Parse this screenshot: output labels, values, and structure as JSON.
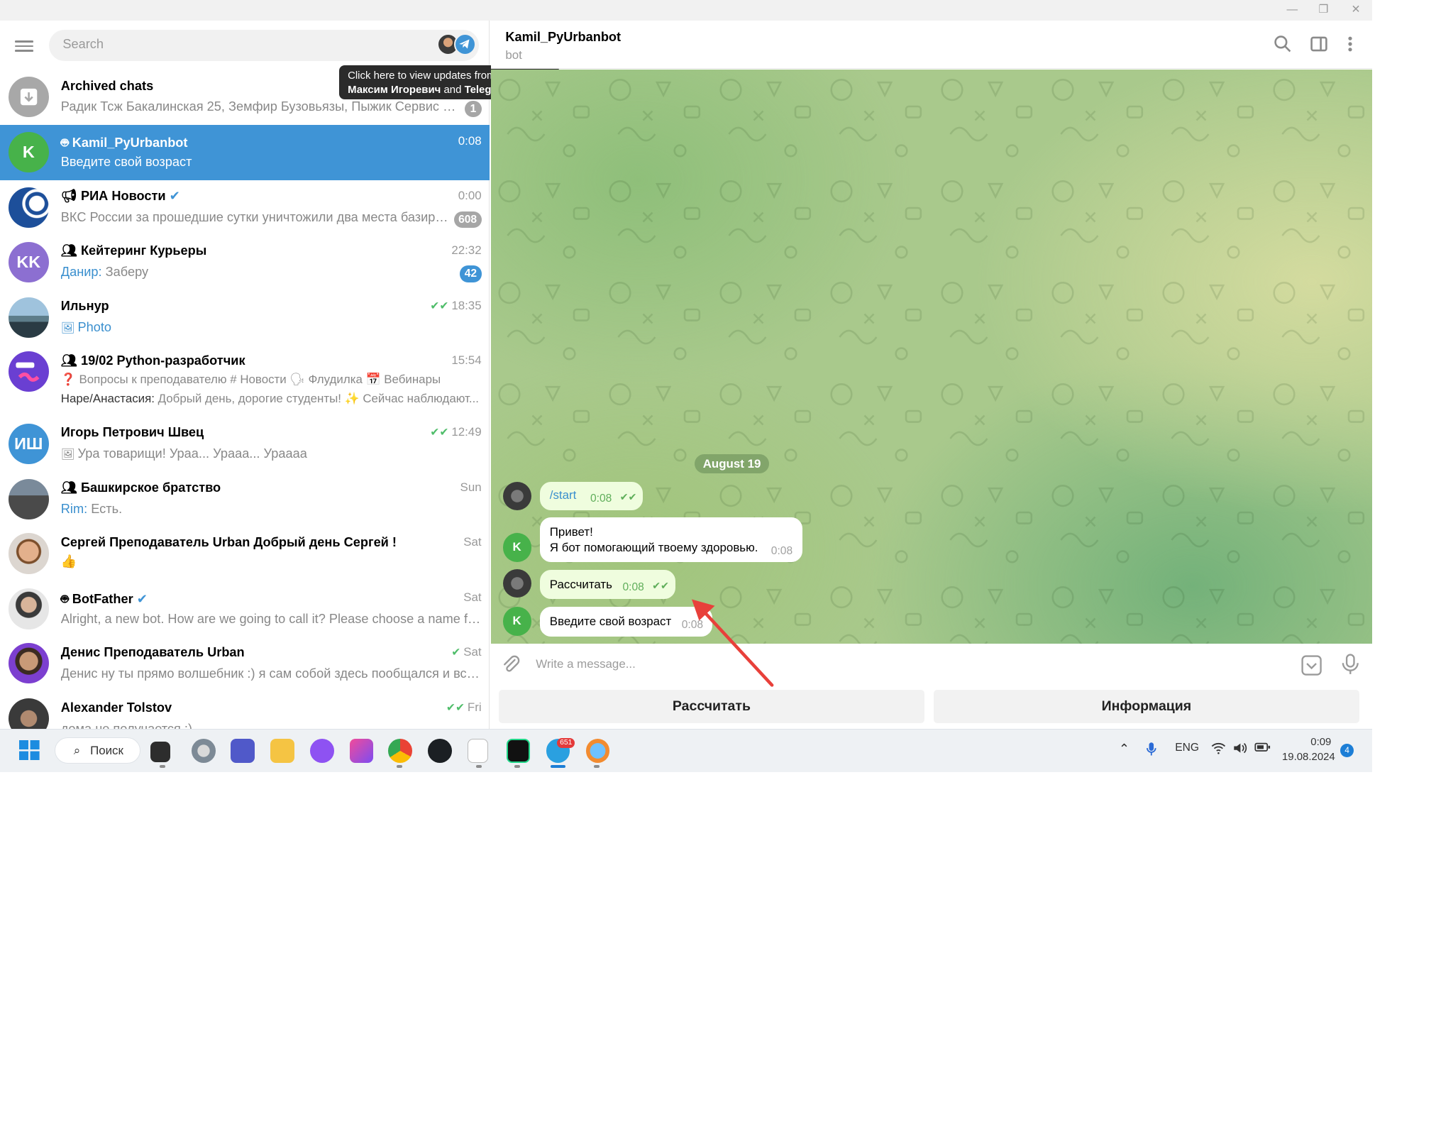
{
  "window": {
    "minimize": "—",
    "restore": "❐",
    "close": "✕"
  },
  "search": {
    "placeholder": "Search"
  },
  "tooltip": {
    "line1": "Click here to view updates from",
    "name1": "Максим Игоревич",
    "and": " and ",
    "name2": "Telegram",
    "dot": "."
  },
  "chats": [
    {
      "name": "Archived chats",
      "preview": "Радик Тсж Бакалинская 25, Земфир Бузовьязы, Пыжик Сервис На Бака...",
      "badge": "1"
    },
    {
      "name": "Kamil_PyUrbanbot",
      "time": "0:08",
      "preview": "Введите свой возраст",
      "avatar": "K"
    },
    {
      "name": "РИА Новости",
      "time": "0:00",
      "preview": "ВКС России за прошедшие сутки уничтожили два места базирован...",
      "badge": "608"
    },
    {
      "name": "Кейтеринг Курьеры",
      "time": "22:32",
      "sender": "Данир:",
      "preview": " Заберу",
      "badge": "42",
      "avatar": "KK"
    },
    {
      "name": "Ильнур",
      "time": "18:35",
      "preview": "Photo"
    },
    {
      "name": "19/02 Python-разработчик",
      "time": "15:54",
      "topics": "❓ Вопросы к преподавателю  # Новости  🗣 Флудилка  📅 Вебинары",
      "sender": "Наре/Анастасия:",
      "preview": " Добрый день, дорогие студенты! ✨  Сейчас наблюдают..."
    },
    {
      "name": "Игорь Петрович Швец",
      "time": "12:49",
      "preview": "Ура товарищи! Ураа... Урааа... Урааaa",
      "avatar": "ИШ"
    },
    {
      "name": "Башкирское братство",
      "time": "Sun",
      "sender": "Rim:",
      "preview": " Есть."
    },
    {
      "name": "Сергей Преподаватель Urban Добрый день Сергей !",
      "time": "Sat",
      "preview": "👍"
    },
    {
      "name": "BotFather",
      "time": "Sat",
      "preview": "Alright, a new bot. How are we going to call it? Please choose a name for you..."
    },
    {
      "name": "Денис Преподаватель Urban",
      "time": "Sat",
      "preview": "Денис ну ты прямо волшебник :) я сам собой здесь пообщался и все сам ..."
    },
    {
      "name": "Alexander Tolstov",
      "time": "Fri",
      "preview": "дома не получается :)"
    }
  ],
  "header": {
    "title": "Kamil_PyUrbanbot",
    "subtitle": "bot"
  },
  "conversation": {
    "date": "August 19",
    "messages": [
      {
        "text": "/start",
        "time": "0:08"
      },
      {
        "line1": "Привет!",
        "line2": "Я бот помогающий твоему здоровью.",
        "time": "0:08"
      },
      {
        "text": "Рассчитать",
        "time": "0:08"
      },
      {
        "text": "Введите свой возраст",
        "time": "0:08"
      }
    ]
  },
  "composer": {
    "placeholder": "Write a message..."
  },
  "keyboard": {
    "btn1": "Рассчитать",
    "btn2": "Информация"
  },
  "taskbar": {
    "search_label": "Поиск",
    "telegram_badge": "651",
    "lang": "ENG",
    "time": "0:09",
    "date": "19.08.2024",
    "notif": "4"
  },
  "colors": {
    "accent": "#3f94d6",
    "bot_avatar": "#47b24a",
    "annotation_arrow": "#e8403a"
  }
}
